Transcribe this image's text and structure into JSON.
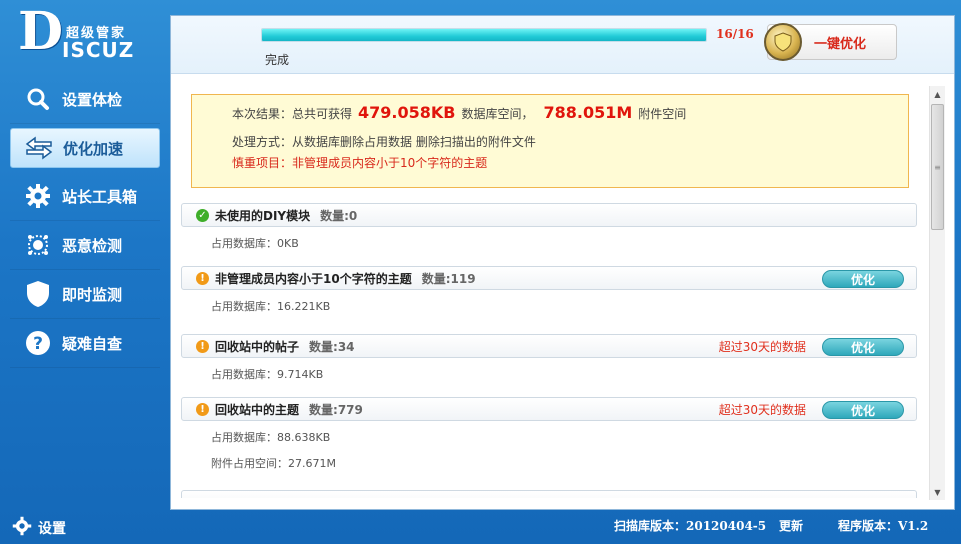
{
  "logo": {
    "letter": "D",
    "subtitle": "超级管家",
    "word": "ISCUZ"
  },
  "sidebar": {
    "items": [
      {
        "label": "设置体检",
        "icon": "search-icon"
      },
      {
        "label": "优化加速",
        "icon": "arrows-icon",
        "active": true
      },
      {
        "label": "站长工具箱",
        "icon": "gear-icon"
      },
      {
        "label": "恶意检测",
        "icon": "virus-icon"
      },
      {
        "label": "即时监测",
        "icon": "shield-icon"
      },
      {
        "label": "疑难自查",
        "icon": "help-icon"
      }
    ]
  },
  "progress": {
    "count": "16/16",
    "status": "完成",
    "fraction": 1.0
  },
  "optimize_all": {
    "label": "一键优化"
  },
  "summary": {
    "prefix": "本次结果：总共可获得",
    "db_size": "479.058KB",
    "db_label": "数据库空间，",
    "attach_size": "788.051M",
    "attach_label": "附件空间",
    "method": "处理方式：从数据库删除占用数据 删除扫描出的附件文件",
    "caution": "慎重项目：非管理成员内容小于10个字符的主题"
  },
  "items": [
    {
      "status": "ok",
      "title": "未使用的DIY模块",
      "count": "数量:0",
      "db_usage": "占用数据库：0KB",
      "note": "",
      "button": ""
    },
    {
      "status": "warn",
      "title": "非管理成员内容小于10个字符的主题",
      "count": "数量:119",
      "db_usage": "占用数据库：16.221KB",
      "note": "",
      "button": "优化"
    },
    {
      "status": "warn",
      "title": "回收站中的帖子",
      "count": "数量:34",
      "db_usage": "占用数据库：9.714KB",
      "note": "超过30天的数据",
      "button": "优化"
    },
    {
      "status": "warn",
      "title": "回收站中的主题",
      "count": "数量:779",
      "db_usage": "占用数据库：88.638KB",
      "attach_usage": "附件占用空间：27.671M",
      "note": "超过30天的数据",
      "button": "优化"
    }
  ],
  "footer": {
    "settings": "设置",
    "scan_version": "扫描库版本：20120404-5",
    "update": "更新",
    "program_version": "程序版本：V1.2"
  }
}
